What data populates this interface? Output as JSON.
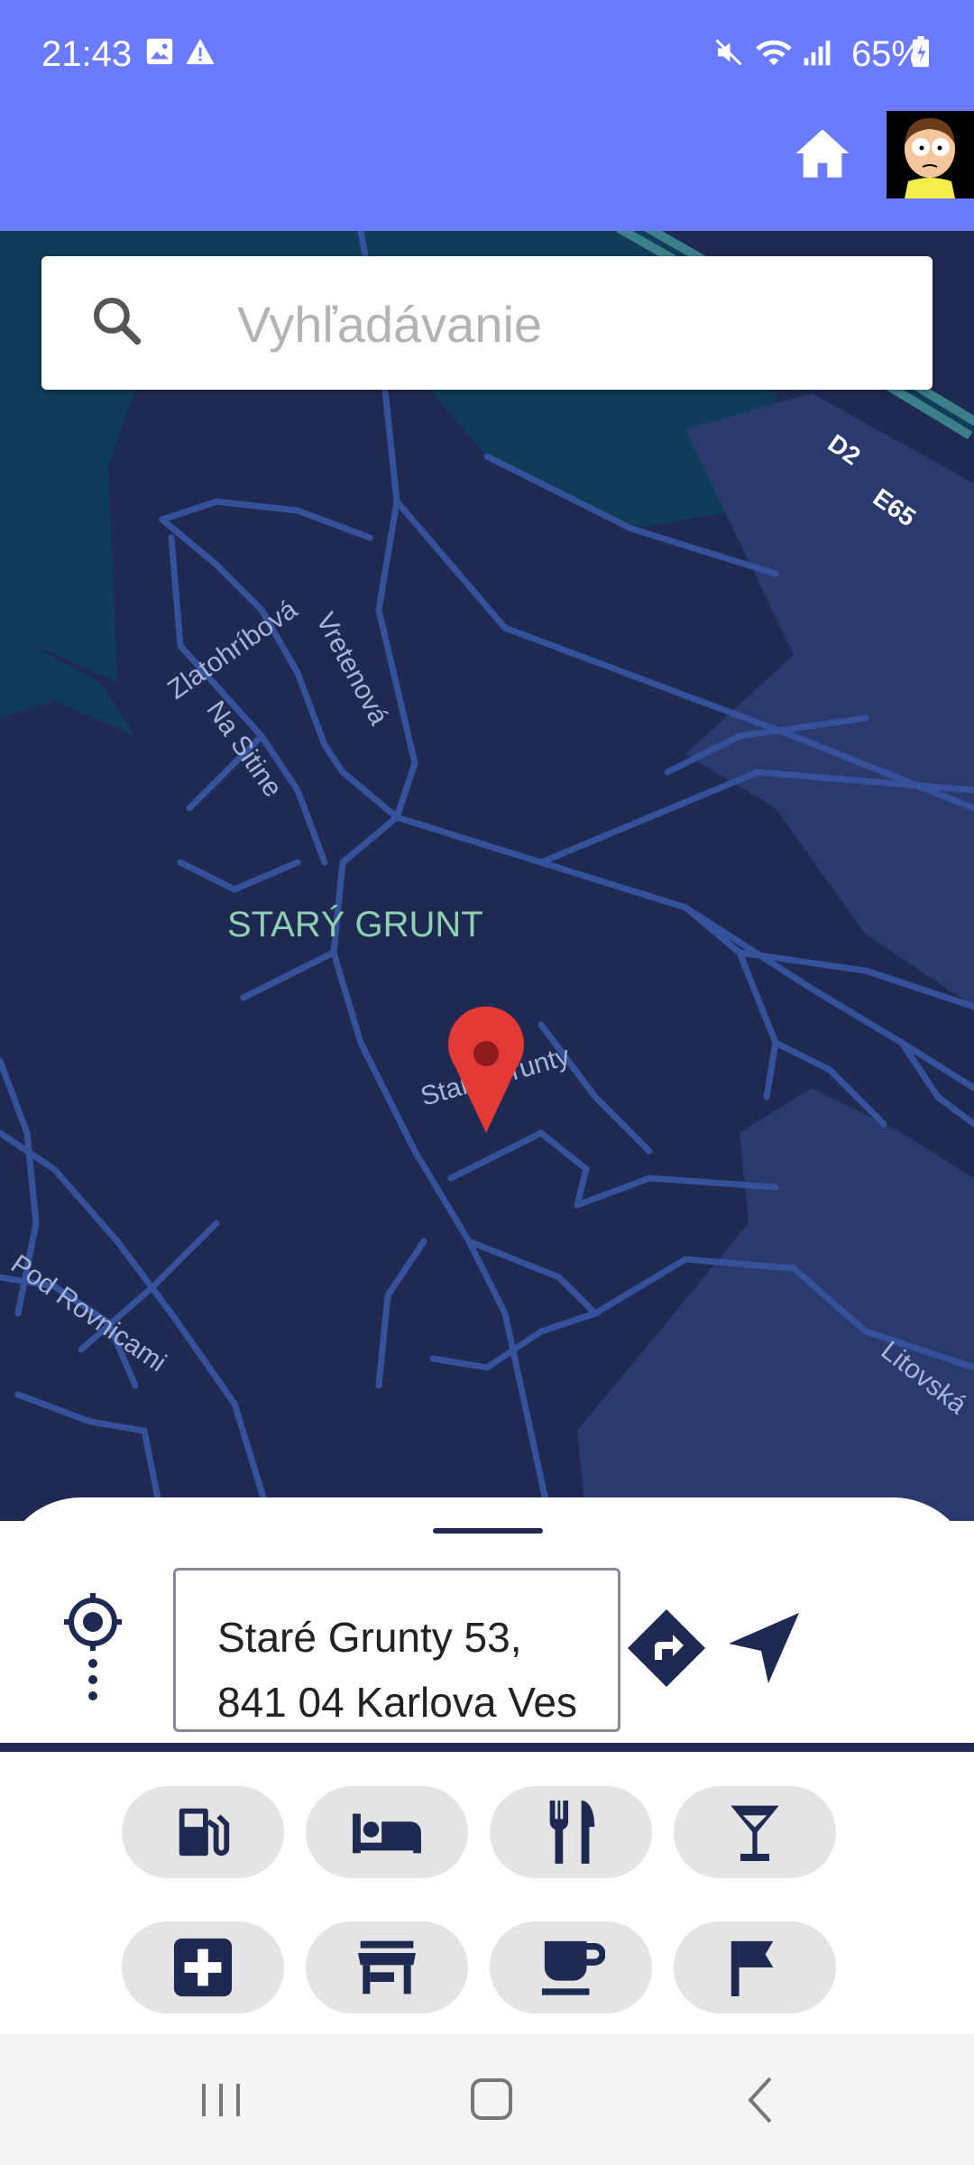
{
  "status": {
    "time": "21:43",
    "battery": "65%"
  },
  "search": {
    "placeholder": "Vyhľadávanie"
  },
  "map": {
    "district_label": "STARÝ GRUNT",
    "street_labels": [
      "Zlatohríbová",
      "Vretenová",
      "Na Sitine",
      "Staré Grunty",
      "Pod Rovnicami",
      "Litovská"
    ],
    "road_shields": [
      "D2",
      "E65"
    ]
  },
  "address": {
    "value": "Staré Grunty 53,\n841 04 Karlova Ves"
  },
  "poi_categories": [
    {
      "icon": "gas-station-icon"
    },
    {
      "icon": "hotel-icon"
    },
    {
      "icon": "restaurant-icon"
    },
    {
      "icon": "bar-icon"
    },
    {
      "icon": "pharmacy-icon"
    },
    {
      "icon": "store-icon"
    },
    {
      "icon": "cafe-icon"
    },
    {
      "icon": "flag-icon"
    }
  ],
  "colors": {
    "app_bar": "#6b7bff",
    "map_land": "#1f2a52",
    "map_water": "#0f3d59",
    "pin": "#e53935",
    "accent_dark": "#1f2a52"
  }
}
